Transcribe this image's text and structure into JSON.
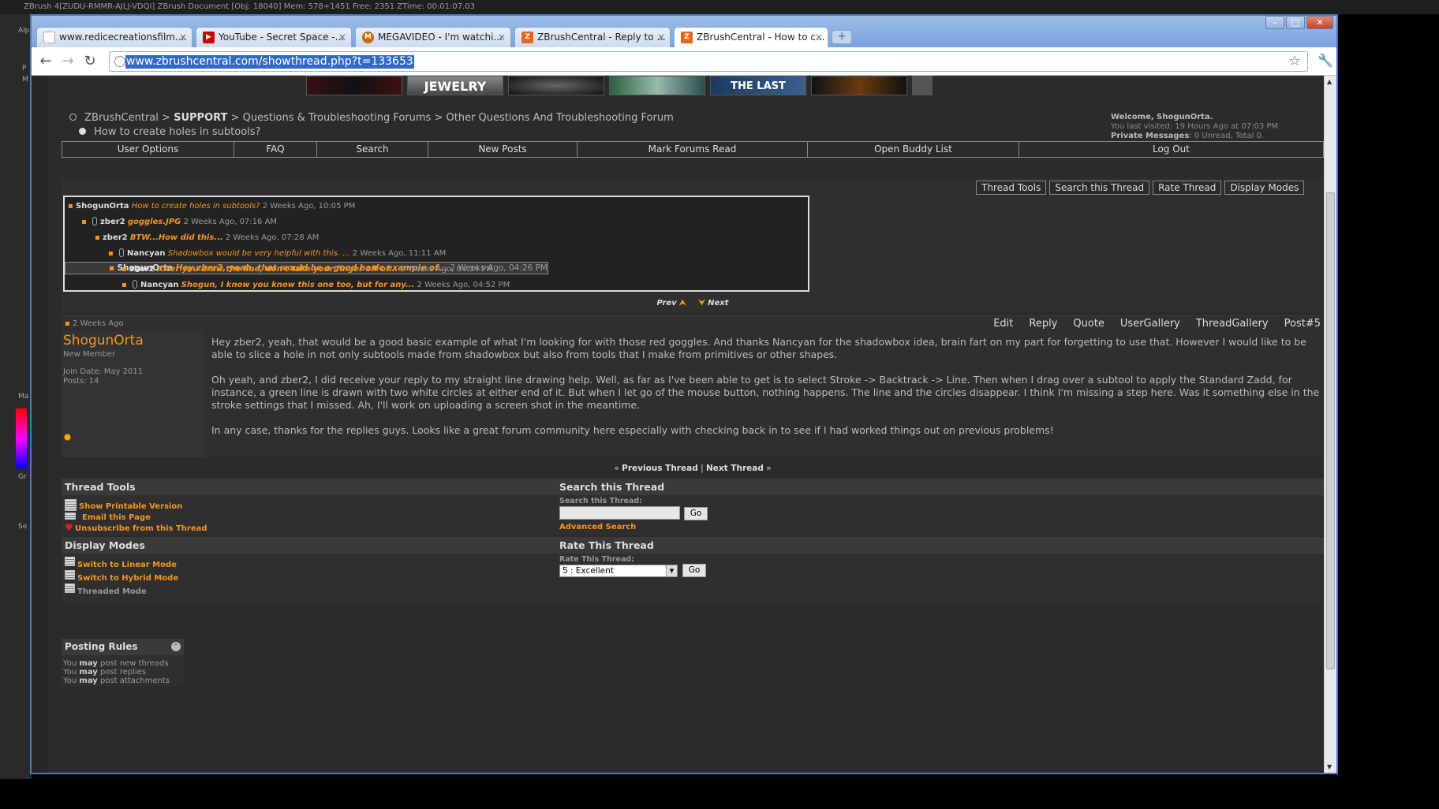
{
  "background_app": {
    "title_bar": "ZBrush 4[ZUDU-RMMR-AJLJ-VDQI]    ZBrush Document    [Obj: 18040] Mem: 578+1451 Free: 2351 ZTime: 00:01:07.03",
    "left_labels": [
      "Alp",
      "P",
      "M",
      "Ma",
      "Gr",
      "Se"
    ]
  },
  "browser": {
    "tabs": [
      {
        "label": "www.redicecreationsfilm....",
        "icon": "page-icon",
        "close": "×"
      },
      {
        "label": "YouTube - Secret Space -...",
        "icon": "youtube-icon",
        "close": "×"
      },
      {
        "label": "MEGAVIDEO - I'm watchi...",
        "icon": "megavideo-icon",
        "close": "×"
      },
      {
        "label": "ZBrushCentral - Reply to ...",
        "icon": "zbrush-icon",
        "close": "×"
      },
      {
        "label": "ZBrushCentral - How to c...",
        "icon": "zbrush-icon",
        "close": "×"
      }
    ],
    "new_tab": "+",
    "window_buttons": {
      "minimize": "–",
      "maximize": "□",
      "close": "✕"
    },
    "nav": {
      "back": "←",
      "forward": "→",
      "reload": "↻"
    },
    "url": "www.zbrushcentral.com/showthread.php?t=133653",
    "star": "☆",
    "wrench": "🔧"
  },
  "page": {
    "banners": [
      "",
      "JEWELRY",
      "",
      "",
      "THE LAST CAUSE",
      "",
      ""
    ],
    "breadcrumb": {
      "site": "ZBrushCentral",
      "sep": ">",
      "section": "SUPPORT",
      "forum": "Questions & Troubleshooting Forums",
      "subforum": "Other Questions And Troubleshooting Forum",
      "thread_title": "How to create holes in subtools?"
    },
    "welcome": {
      "line1": "Welcome, ShogunOrta.",
      "line2": "You last visited: 19 Hours Ago at 07:03 PM",
      "pm_label": "Private Messages",
      "pm_value": ": 0 Unread, Total 0."
    },
    "navbar": [
      "User Options",
      "FAQ",
      "Search",
      "New Posts",
      "Mark Forums Read",
      "Open Buddy List",
      "Log Out"
    ],
    "thread_tools_buttons": [
      "Thread Tools",
      "Search this Thread",
      "Rate Thread",
      "Display Modes"
    ],
    "tree": [
      {
        "user": "ShogunOrta",
        "title": "How to create holes in subtools?",
        "date": "2 Weeks Ago, 10:05 PM",
        "indent": 0,
        "clip": false,
        "plain": true
      },
      {
        "user": "zber2",
        "title": "goggles.JPG",
        "date": "2 Weeks Ago, 07:16 AM",
        "indent": 1,
        "clip": true,
        "plain": false
      },
      {
        "user": "zber2",
        "title": "BTW...How did this...",
        "date": "2 Weeks Ago, 07:28 AM",
        "indent": 2,
        "clip": false,
        "plain": false
      },
      {
        "user": "Nancyan",
        "title": "Shadowbox would be very helpful with this. ...",
        "date": "2 Weeks Ago, 11:11 AM",
        "indent": 3,
        "clip": true,
        "plain": true
      },
      {
        "user": "ShogunOrta",
        "title": "Hey zber2, yeah, that would be a good basic example of...",
        "date": "2 Weeks Ago, 04:26 PM",
        "indent": 3,
        "clip": false,
        "plain": false,
        "selected": true
      },
      {
        "user": "zber2",
        "title": "After you draw the line, don't take your finger off of...",
        "date": "2 Weeks Ago, 04:34 PM",
        "indent": 4,
        "clip": false,
        "plain": false
      },
      {
        "user": "Nancyan",
        "title": "Shogun, I know you know this one too, but for any...",
        "date": "2 Weeks Ago, 04:52 PM",
        "indent": 4,
        "clip": true,
        "plain": false
      }
    ],
    "prevnext": {
      "prev": "Prev",
      "next": "Next",
      "up": "⮝",
      "down": "⮟"
    },
    "post": {
      "date": "2 Weeks Ago",
      "actions": [
        "Edit",
        "Reply",
        "Quote",
        "UserGallery",
        "ThreadGallery",
        "Post#5"
      ],
      "username": "ShogunOrta",
      "rank": "New Member",
      "join": "Join Date: May 2011",
      "posts": "Posts: 14",
      "paragraphs": [
        "Hey zber2, yeah, that would be a good basic example of what I'm looking for with those red goggles. And thanks Nancyan for the shadowbox idea, brain fart on my part for forgetting to use that. However I would like to be able to slice a hole in not only subtools made from shadowbox but also from tools that I make from primitives or other shapes.",
        "Oh yeah, and zber2, I did receive your reply to my straight line drawing help. Well, as far as I've been able to get is to select Stroke -> Backtrack -> Line. Then when I drag over a subtool to apply the Standard Zadd, for instance, a green line is drawn with two white circles at either end of it. But when I let go of the mouse button, nothing happens. The line and the circles disappear. I think I'm missing a step here. Was it something else in the stroke settings that I missed. Ah, I'll work on uploading a screen shot in the meantime.",
        "In any case, thanks for the replies guys. Looks like a great forum community here especially with checking back in to see if I had worked things out on previous problems!"
      ]
    },
    "thread_nav": {
      "prev": "Previous Thread",
      "next": "Next Thread",
      "sep": "|",
      "lq": "«",
      "rq": "»"
    },
    "thread_tools_panel": {
      "title": "Thread Tools",
      "links": [
        "Show Printable Version",
        "Email this Page",
        "Unsubscribe from this Thread"
      ]
    },
    "search_panel": {
      "title": "Search this Thread",
      "label": "Search this Thread:",
      "value": "",
      "go": "Go",
      "advanced": "Advanced Search"
    },
    "display_panel": {
      "title": "Display Modes",
      "links": [
        "Switch to Linear Mode",
        "Switch to Hybrid Mode",
        "Threaded Mode"
      ]
    },
    "rate_panel": {
      "title": "Rate This Thread",
      "label": "Rate This Thread:",
      "selected": "5 : Excellent",
      "go": "Go"
    },
    "posting_rules": {
      "title": "Posting Rules",
      "lines": [
        {
          "pre": "You ",
          "b": "may",
          "post": " post new threads"
        },
        {
          "pre": "You ",
          "b": "may",
          "post": " post replies"
        },
        {
          "pre": "You ",
          "b": "may",
          "post": " post attachments"
        }
      ]
    }
  },
  "colors": {
    "accent": "#f7941d",
    "page_bg": "#2b2b2b",
    "browser_frame": "#4a78c2"
  }
}
